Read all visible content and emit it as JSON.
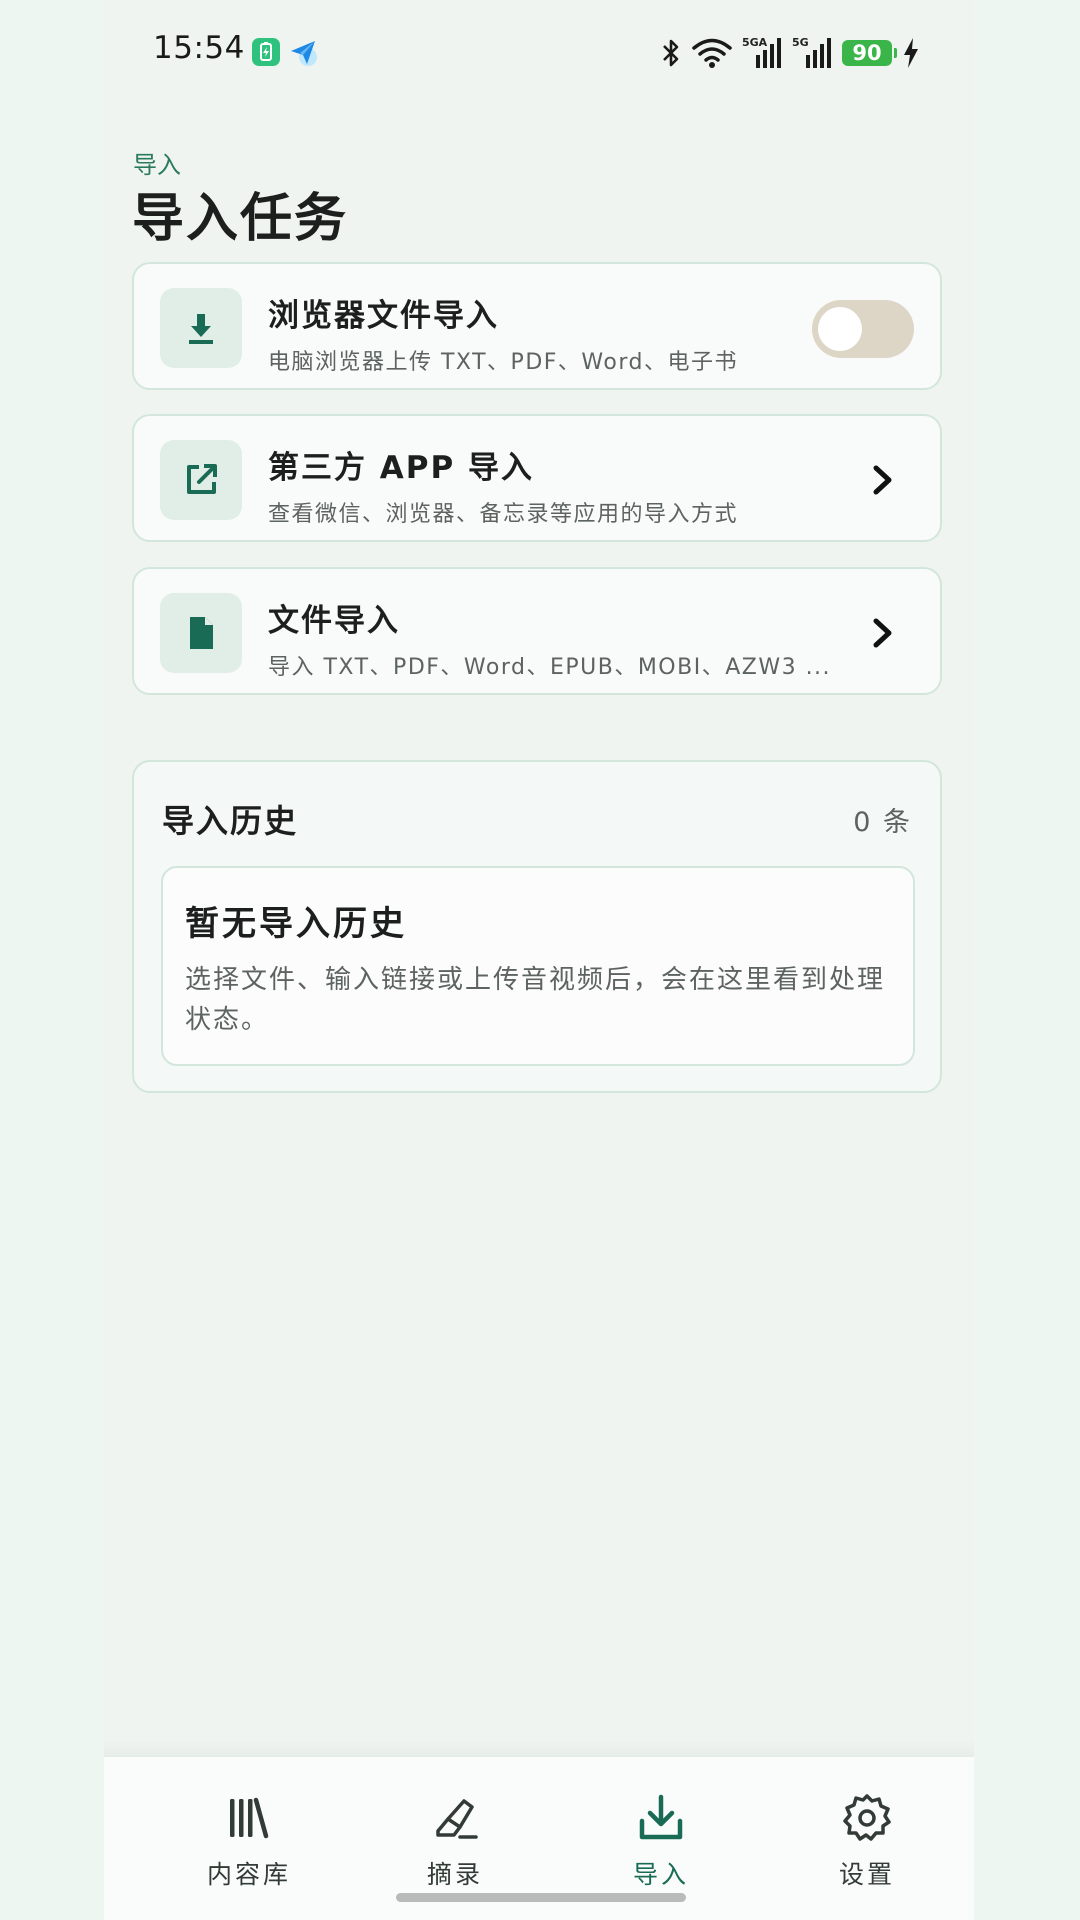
{
  "status_bar": {
    "time": "15:54",
    "network_1": "5GA",
    "network_2": "5G",
    "battery": "90"
  },
  "header": {
    "eyebrow": "导入",
    "title": "导入任务"
  },
  "options": [
    {
      "title": "浏览器文件导入",
      "subtitle": "电脑浏览器上传 TXT、PDF、Word、电子书",
      "icon": "download-icon",
      "control": "toggle",
      "toggle_on": false
    },
    {
      "title": "第三方 APP 导入",
      "subtitle": "查看微信、浏览器、备忘录等应用的导入方式",
      "icon": "external-link-icon",
      "control": "chevron"
    },
    {
      "title": "文件导入",
      "subtitle": "导入 TXT、PDF、Word、EPUB、MOBI、AZW3 ...",
      "icon": "file-icon",
      "control": "chevron"
    }
  ],
  "history": {
    "title": "导入历史",
    "count": "0 条",
    "empty_title": "暂无导入历史",
    "empty_desc": "选择文件、输入链接或上传音视频后，会在这里看到处理状态。"
  },
  "nav": [
    {
      "label": "内容库",
      "icon": "library-icon",
      "active": false
    },
    {
      "label": "摘录",
      "icon": "highlighter-icon",
      "active": false
    },
    {
      "label": "导入",
      "icon": "import-icon",
      "active": true
    },
    {
      "label": "设置",
      "icon": "gear-icon",
      "active": false
    }
  ],
  "colors": {
    "accent": "#1a6b55",
    "background": "#eff4f1",
    "card_border": "#d3e6dc",
    "toggle_off": "#ddd6c6"
  }
}
